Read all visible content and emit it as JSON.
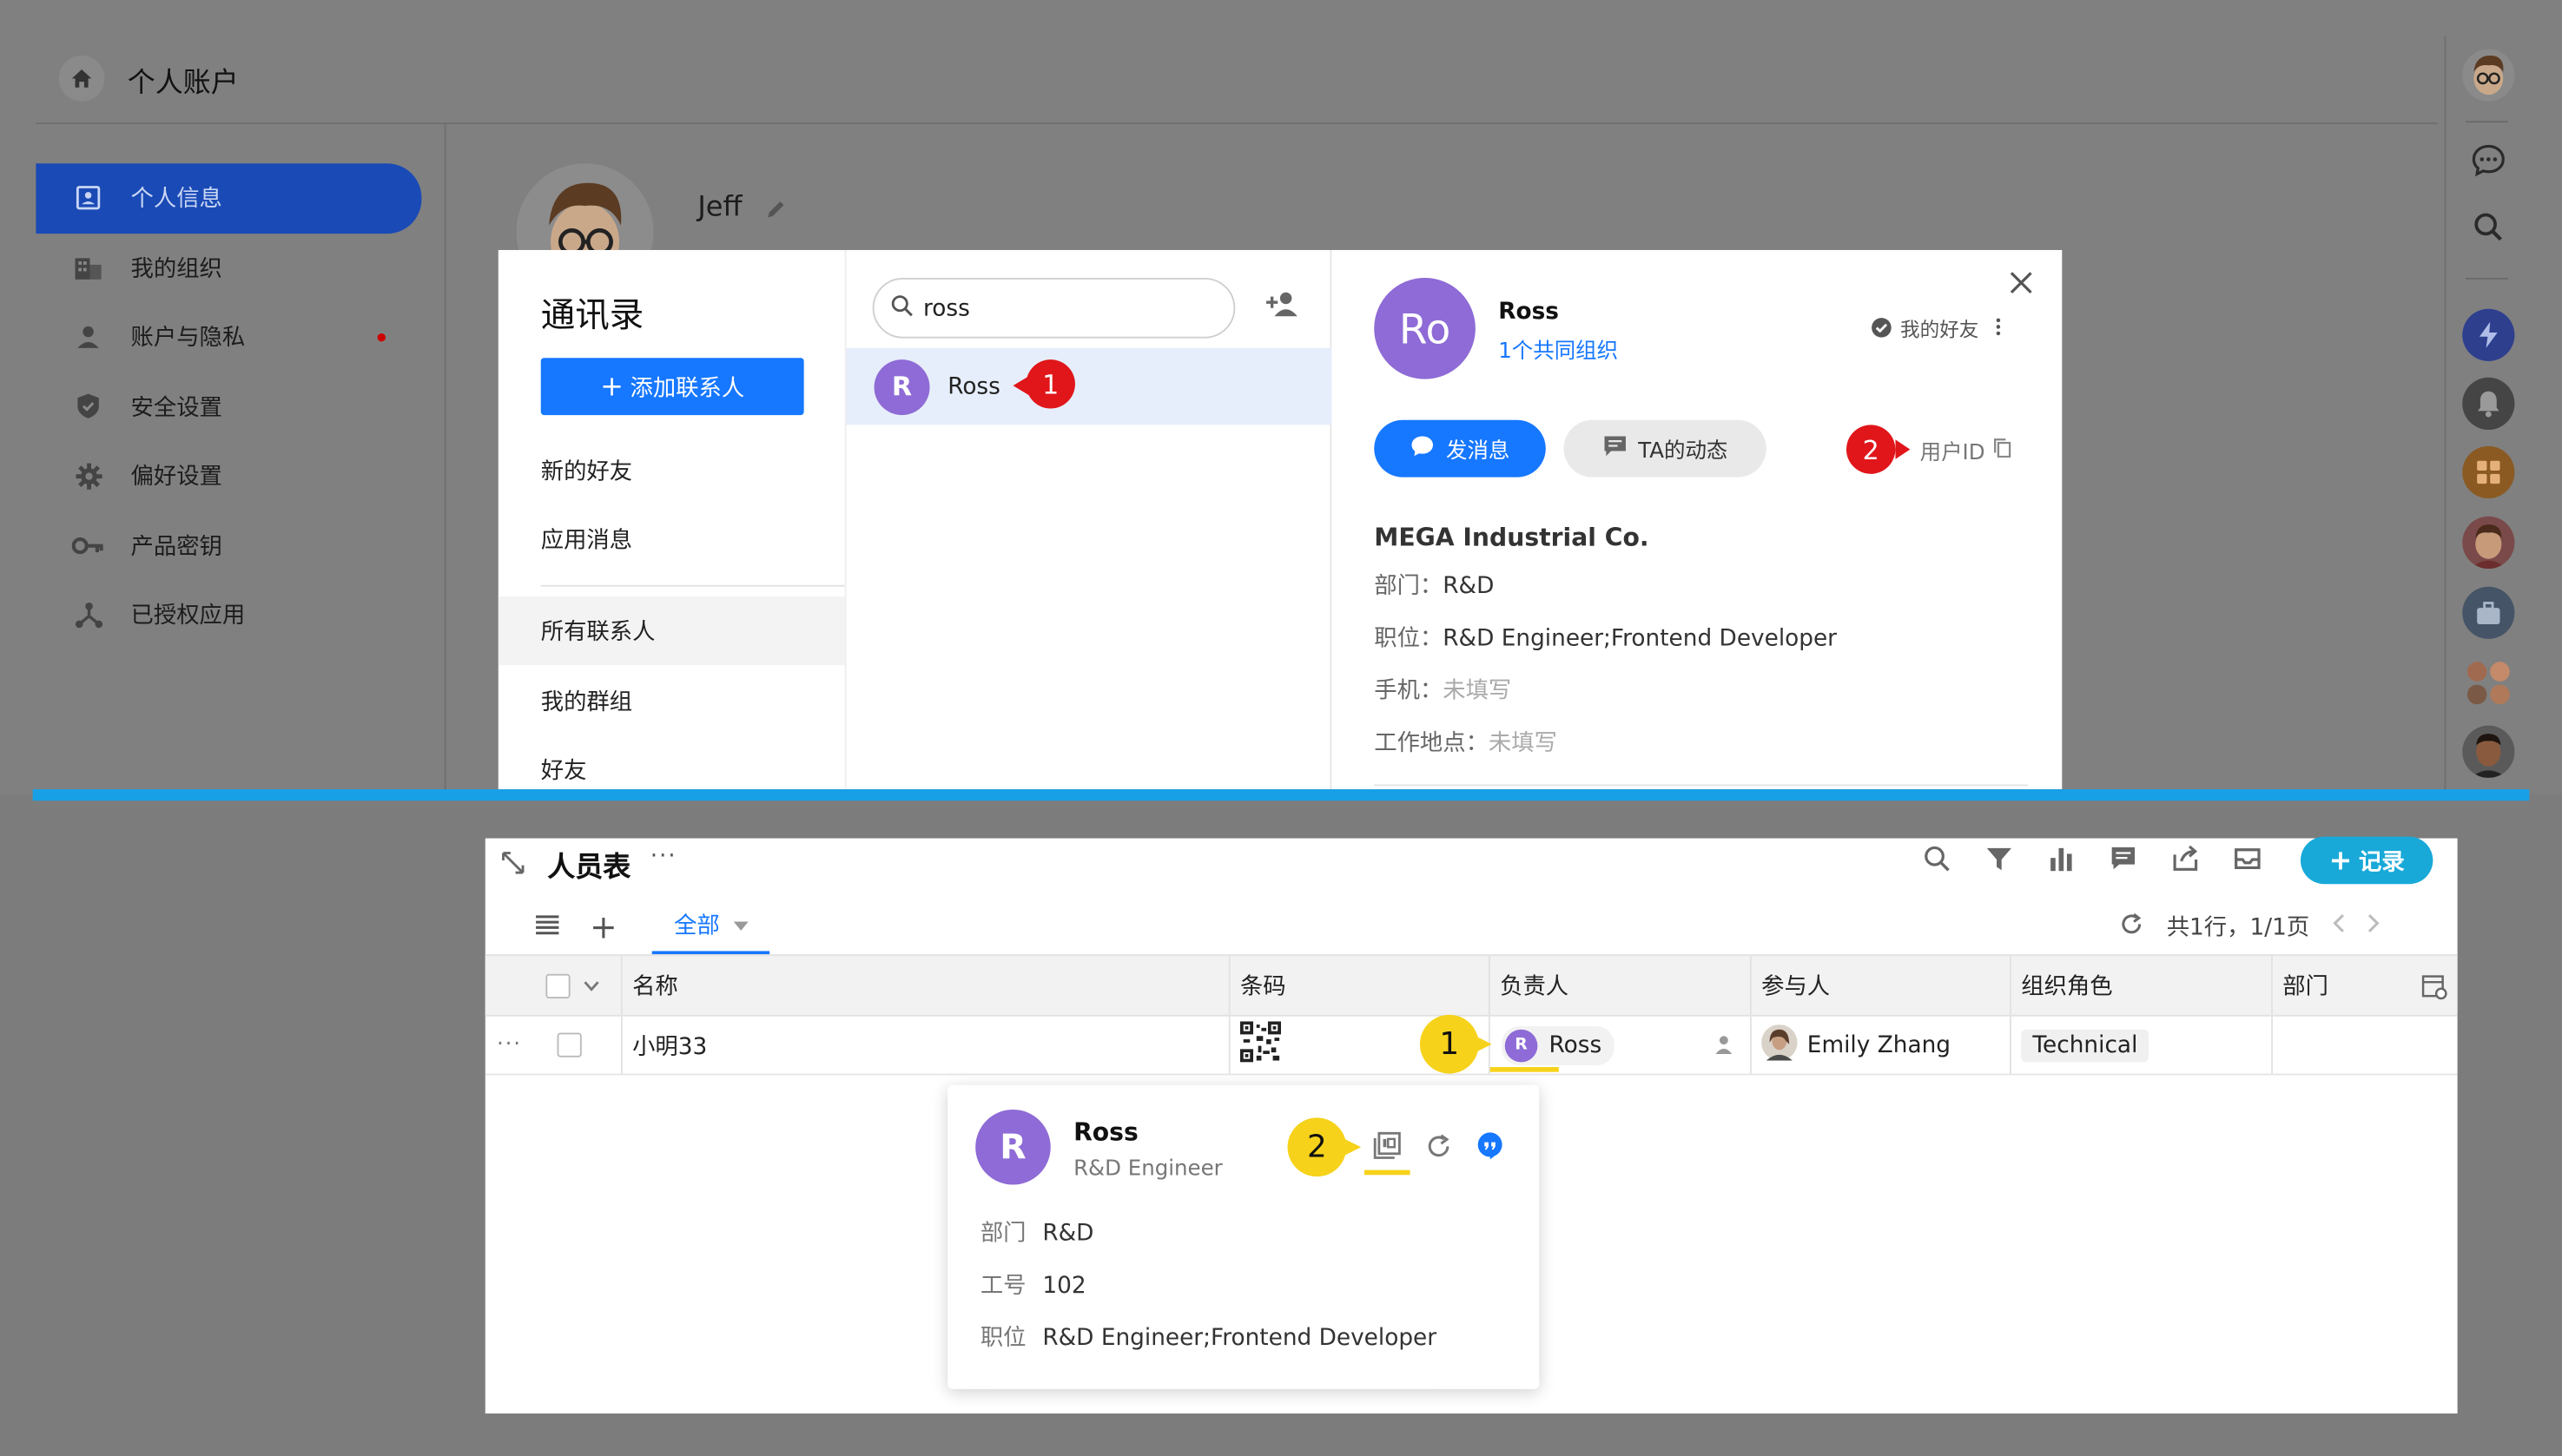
{
  "top": {
    "header": {
      "title": "个人账户"
    },
    "sidebar": {
      "items": [
        {
          "label": "个人信息",
          "icon": "profile-card-icon",
          "active": true
        },
        {
          "label": "我的组织",
          "icon": "building-icon"
        },
        {
          "label": "账户与隐私",
          "icon": "person-icon",
          "dot": true
        },
        {
          "label": "安全设置",
          "icon": "shield-icon"
        },
        {
          "label": "偏好设置",
          "icon": "gear-icon"
        },
        {
          "label": "产品密钥",
          "icon": "key-icon"
        },
        {
          "label": "已授权应用",
          "icon": "graph-nodes-icon"
        }
      ]
    },
    "profile": {
      "name": "Jeff"
    },
    "contacts_modal": {
      "title": "通讯录",
      "add_contact_label": "添加联系人",
      "menu": [
        "新的好友",
        "应用消息",
        "所有联系人",
        "我的群组",
        "好友"
      ],
      "search": {
        "value": "ross"
      },
      "results": [
        {
          "initial": "R",
          "name": "Ross"
        }
      ],
      "detail": {
        "initials": "Ro",
        "name": "Ross",
        "shared_orgs": "1个共同组织",
        "relation": "我的好友",
        "message_label": "发消息",
        "activity_label": "TA的动态",
        "user_id_label": "用户ID",
        "company": "MEGA Industrial Co.",
        "fields": [
          {
            "key": "部门：",
            "value": "R&D",
            "muted": false
          },
          {
            "key": "职位：",
            "value": "R&D Engineer;Frontend Developer",
            "muted": false
          },
          {
            "key": "手机：",
            "value": "未填写",
            "muted": true
          },
          {
            "key": "工作地点：",
            "value": "未填写",
            "muted": true
          }
        ]
      },
      "markers": [
        "1",
        "2"
      ]
    }
  },
  "bottom": {
    "table_title": "人员表",
    "record_label": "记录",
    "view_tab": "全部",
    "pagination": "共1行，1/1页",
    "columns": [
      "名称",
      "条码",
      "负责人",
      "参与人",
      "组织角色",
      "部门"
    ],
    "rows": [
      {
        "name": "小明33",
        "owner": "Ross",
        "owner_initial": "R",
        "participant": "Emily Zhang",
        "role": "Technical",
        "dept": ""
      }
    ],
    "card": {
      "initial": "R",
      "name": "Ross",
      "role": "R&D Engineer",
      "fields": [
        {
          "key": "部门",
          "value": "R&D"
        },
        {
          "key": "工号",
          "value": "102"
        },
        {
          "key": "职位",
          "value": "R&D Engineer;Frontend Developer"
        }
      ]
    },
    "markers": [
      "1",
      "2"
    ]
  },
  "colors": {
    "accent": "#1677ff",
    "active_nav": "#1a4ab5",
    "avatar_purple": "#8e6bd6",
    "marker_red": "#e0161a",
    "marker_yellow": "#f6d21a",
    "divider_blue": "#18a0e6",
    "record_button": "#18a9d9"
  }
}
